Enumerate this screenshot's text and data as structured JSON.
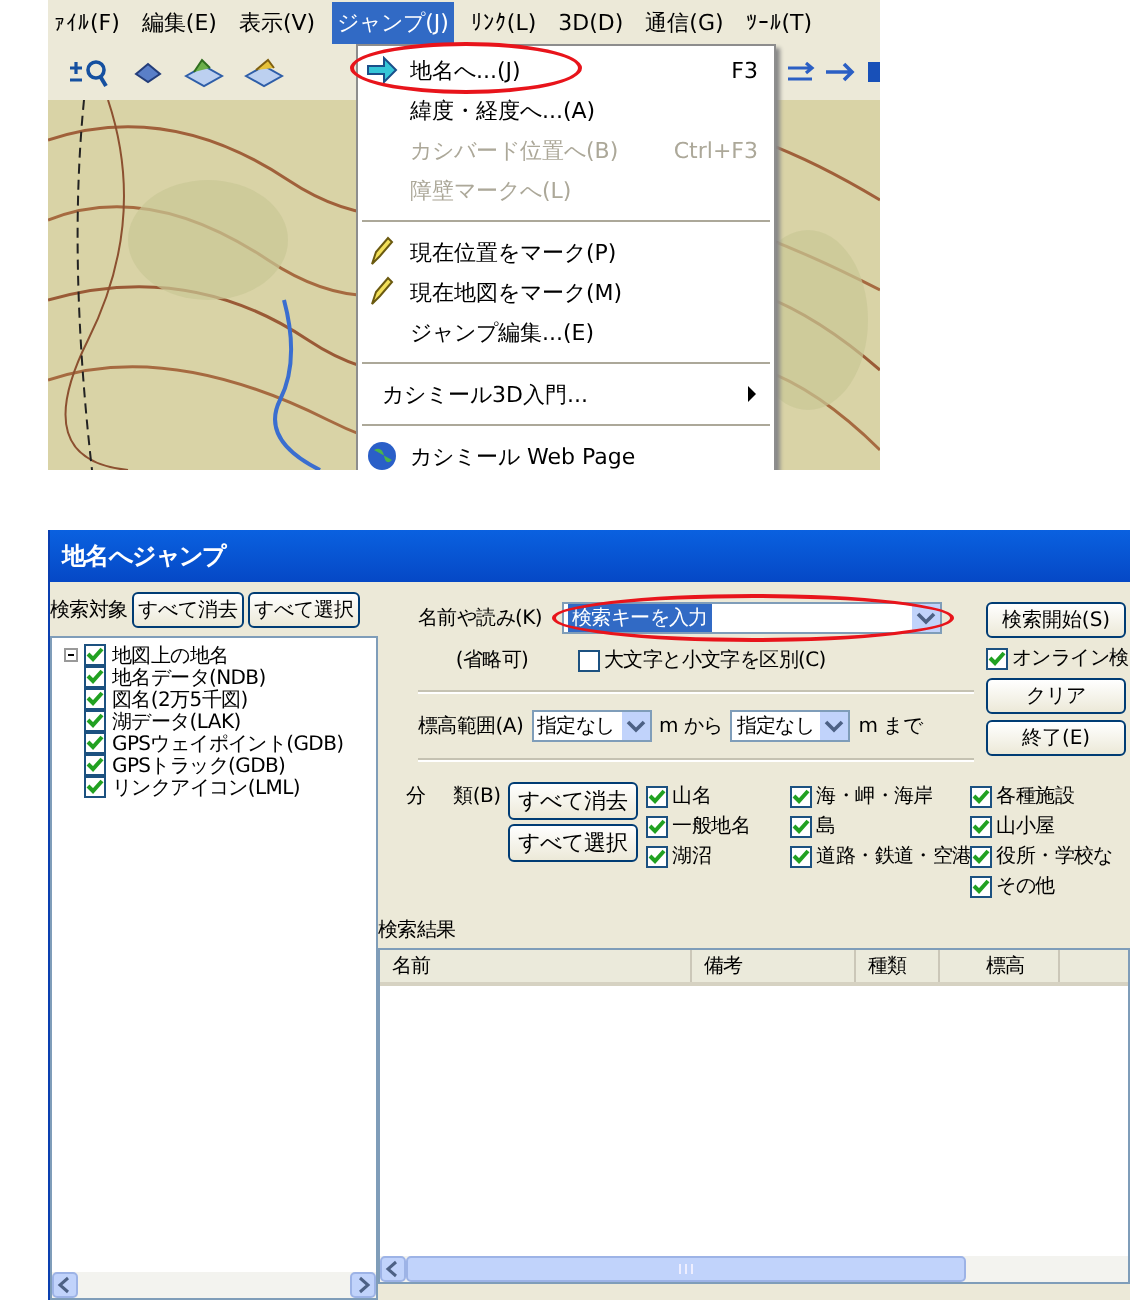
{
  "main_window": {
    "menu_bar": [
      {
        "label": "ｧｲﾙ(F)",
        "selected": false
      },
      {
        "label": "編集(E)",
        "selected": false
      },
      {
        "label": "表示(V)",
        "selected": false
      },
      {
        "label": "ジャンプ(J)",
        "selected": true
      },
      {
        "label": "ﾘﾝｸ(L)",
        "selected": false
      },
      {
        "label": "3D(D)",
        "selected": false
      },
      {
        "label": "通信(G)",
        "selected": false
      },
      {
        "label": "ﾂｰﾙ(T)",
        "selected": false
      }
    ],
    "jump_menu": [
      {
        "kind": "arrow",
        "label": "地名へ...(J)",
        "shortcut": "F3",
        "disabled": false,
        "circled": true
      },
      {
        "kind": "plain",
        "label": "緯度・経度へ...(A)",
        "disabled": false,
        "circled": false
      },
      {
        "kind": "plain",
        "label": "カシバード位置へ(B)",
        "shortcut": "Ctrl+F3",
        "disabled": true,
        "circled": false
      },
      {
        "kind": "plain",
        "label": "障壁マークへ(L)",
        "disabled": true,
        "circled": false
      },
      {
        "kind": "separator"
      },
      {
        "kind": "mark",
        "label": "現在位置をマーク(P)",
        "disabled": false,
        "circled": false
      },
      {
        "kind": "mark",
        "label": "現在地図をマーク(M)",
        "disabled": false,
        "circled": false
      },
      {
        "kind": "plain",
        "label": "ジャンプ編集...(E)",
        "disabled": false,
        "circled": false
      },
      {
        "kind": "separator"
      },
      {
        "kind": "submenu",
        "label": "カシミール3D入門...",
        "disabled": false,
        "circled": false
      },
      {
        "kind": "separator"
      },
      {
        "kind": "globe",
        "label": "カシミール Web Page",
        "disabled": false,
        "circled": false
      }
    ]
  },
  "jump_dialog": {
    "title": "地名へジャンプ",
    "search_target": {
      "label": "検索対象",
      "buttons": [
        "すべて消去",
        "すべて選択"
      ],
      "tree": [
        {
          "label": "地図上の地名",
          "checked": true,
          "expander": true
        },
        {
          "label": "地名データ(NDB)",
          "checked": true,
          "expander": false
        },
        {
          "label": "図名(2万5千図)",
          "checked": true,
          "expander": false
        },
        {
          "label": "湖データ(LAK)",
          "checked": true,
          "expander": false
        },
        {
          "label": "GPSウェイポイント(GDB)",
          "checked": true,
          "expander": false
        },
        {
          "label": "GPSトラック(GDB)",
          "checked": true,
          "expander": false
        },
        {
          "label": "リンクアイコン(LML)",
          "checked": true,
          "expander": false
        }
      ]
    },
    "name_field": {
      "label": "名前や読み(K)",
      "value": "検索キーを入力",
      "value_selected": true,
      "circled": true,
      "note": "(省略可)"
    },
    "case_option": {
      "label": "大文字と小文字を区別(C)",
      "checked": false
    },
    "side_controls": [
      {
        "kind": "button",
        "label": "検索開始(S)"
      },
      {
        "kind": "checkbox",
        "label": "オンライン検",
        "checked": true
      },
      {
        "kind": "button",
        "label": "クリア"
      },
      {
        "kind": "button",
        "label": "終了(E)"
      }
    ],
    "elevation": {
      "label": "標高範囲(A)",
      "from": "指定なし",
      "from_unit": "m から",
      "to": "指定なし",
      "to_unit": "m まで"
    },
    "category": {
      "label_left": "分",
      "label_right": "類(B)",
      "buttons": [
        "すべて消去",
        "すべて選択"
      ],
      "columns": [
        [
          {
            "label": "山名",
            "checked": true
          },
          {
            "label": "一般地名",
            "checked": true
          },
          {
            "label": "湖沼",
            "checked": true
          }
        ],
        [
          {
            "label": "海・岬・海岸",
            "checked": true
          },
          {
            "label": "島",
            "checked": true
          },
          {
            "label": "道路・鉄道・空港",
            "checked": true
          }
        ],
        [
          {
            "label": "各種施設",
            "checked": true
          },
          {
            "label": "山小屋",
            "checked": true
          },
          {
            "label": "役所・学校な",
            "checked": true
          },
          {
            "label": "その他",
            "checked": true
          }
        ]
      ]
    },
    "results": {
      "label": "検索結果",
      "columns": [
        "名前",
        "備考",
        "種類",
        "標高"
      ]
    }
  }
}
